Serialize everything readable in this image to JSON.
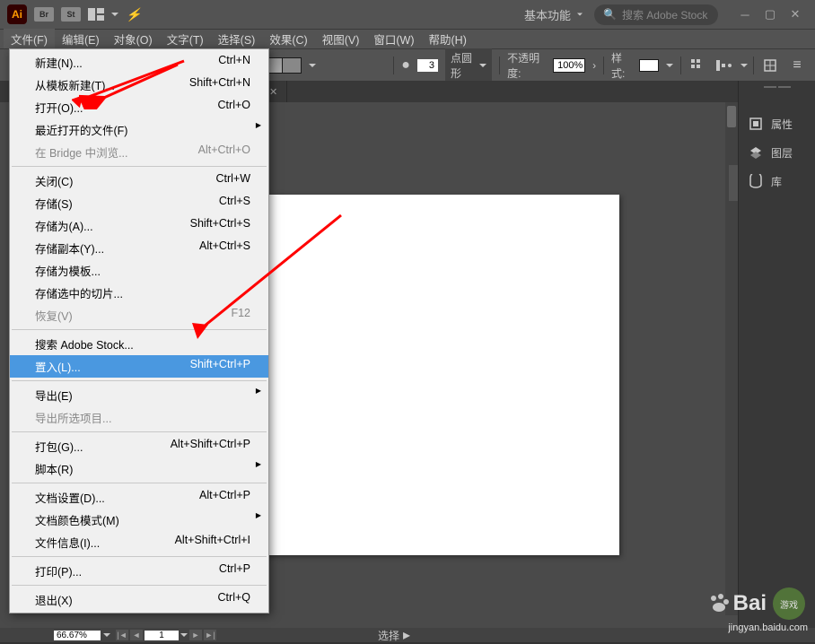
{
  "app_icon": "Ai",
  "title_icons": {
    "br": "Br",
    "st": "St"
  },
  "workspace": "基本功能",
  "search_placeholder": "搜索 Adobe Stock",
  "menubar": [
    "文件(F)",
    "编辑(E)",
    "对象(O)",
    "文字(T)",
    "选择(S)",
    "效果(C)",
    "视图(V)",
    "窗口(W)",
    "帮助(H)"
  ],
  "options": {
    "stroke_pt": "3",
    "stroke_shape": "点圆形",
    "opacity_label": "不透明度:",
    "opacity_value": "100%",
    "style_label": "样式:"
  },
  "panels": [
    "属性",
    "图层",
    "库"
  ],
  "file_menu": [
    {
      "label": "新建(N)...",
      "shortcut": "Ctrl+N"
    },
    {
      "label": "从模板新建(T)...",
      "shortcut": "Shift+Ctrl+N"
    },
    {
      "label": "打开(O)...",
      "shortcut": "Ctrl+O"
    },
    {
      "label": "最近打开的文件(F)",
      "shortcut": "",
      "sub": true
    },
    {
      "label": "在 Bridge 中浏览...",
      "shortcut": "Alt+Ctrl+O",
      "disabled": true
    },
    {
      "sep": true
    },
    {
      "label": "关闭(C)",
      "shortcut": "Ctrl+W"
    },
    {
      "label": "存储(S)",
      "shortcut": "Ctrl+S"
    },
    {
      "label": "存储为(A)...",
      "shortcut": "Shift+Ctrl+S"
    },
    {
      "label": "存储副本(Y)...",
      "shortcut": "Alt+Ctrl+S"
    },
    {
      "label": "存储为模板..."
    },
    {
      "label": "存储选中的切片..."
    },
    {
      "label": "恢复(V)",
      "shortcut": "F12",
      "disabled": true
    },
    {
      "sep": true
    },
    {
      "label": "搜索 Adobe Stock..."
    },
    {
      "label": "置入(L)...",
      "shortcut": "Shift+Ctrl+P",
      "highlighted": true
    },
    {
      "sep": true
    },
    {
      "label": "导出(E)",
      "sub": true
    },
    {
      "label": "导出所选项目...",
      "disabled": true
    },
    {
      "sep": true
    },
    {
      "label": "打包(G)...",
      "shortcut": "Alt+Shift+Ctrl+P"
    },
    {
      "label": "脚本(R)",
      "sub": true
    },
    {
      "sep": true
    },
    {
      "label": "文档设置(D)...",
      "shortcut": "Alt+Ctrl+P"
    },
    {
      "label": "文档颜色模式(M)",
      "sub": true
    },
    {
      "label": "文件信息(I)...",
      "shortcut": "Alt+Shift+Ctrl+I"
    },
    {
      "sep": true
    },
    {
      "label": "打印(P)...",
      "shortcut": "Ctrl+P"
    },
    {
      "sep": true
    },
    {
      "label": "退出(X)",
      "shortcut": "Ctrl+Q"
    }
  ],
  "zoom": "66.67%",
  "page": "1",
  "status_center": "选择",
  "watermark": {
    "brand": "Bai",
    "sub": "jingyan.baidu.com"
  }
}
